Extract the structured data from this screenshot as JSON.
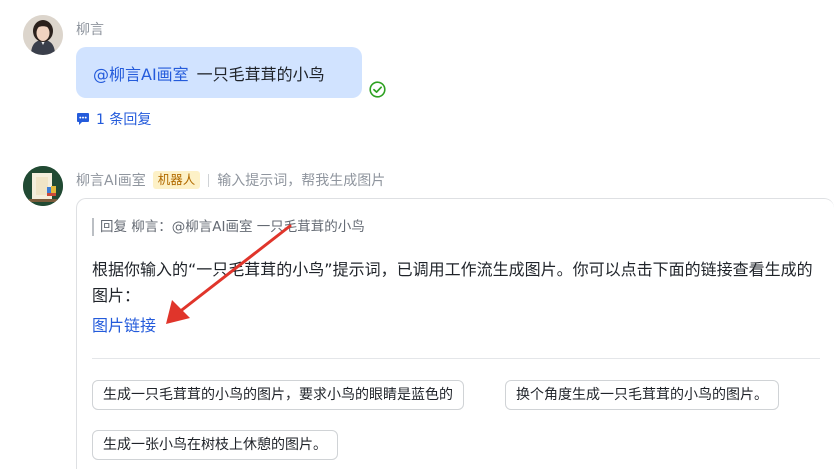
{
  "message1": {
    "sender": "柳言",
    "mention": "@柳言AI画室",
    "text": "一只毛茸茸的小鸟",
    "reply_count": "1 条回复",
    "status_icon": "check-circle-icon",
    "reply_icon": "chat-bubble-icon"
  },
  "message2": {
    "sender": "柳言AI画室",
    "badge": "机器人",
    "description": "输入提示词，帮我生成图片",
    "quote": "回复 柳言：@柳言AI画室 一只毛茸茸的小鸟",
    "answer": "根据你输入的“一只毛茸茸的小鸟”提示词，已调用工作流生成图片。你可以点击下面的链接查看生成的图片：",
    "link_text": "图片链接",
    "suggestions": [
      "生成一只毛茸茸的小鸟的图片，要求小鸟的眼睛是蓝色的",
      "换个角度生成一只毛茸茸的小鸟的图片。",
      "生成一张小鸟在树枝上休憩的图片。"
    ]
  },
  "colors": {
    "accent": "#245bdb",
    "bubble": "#d1e3ff",
    "check": "#2ea121",
    "annotation_arrow": "#e0352b",
    "badge_bg": "#fdf1c7",
    "badge_text": "#b26b00"
  }
}
